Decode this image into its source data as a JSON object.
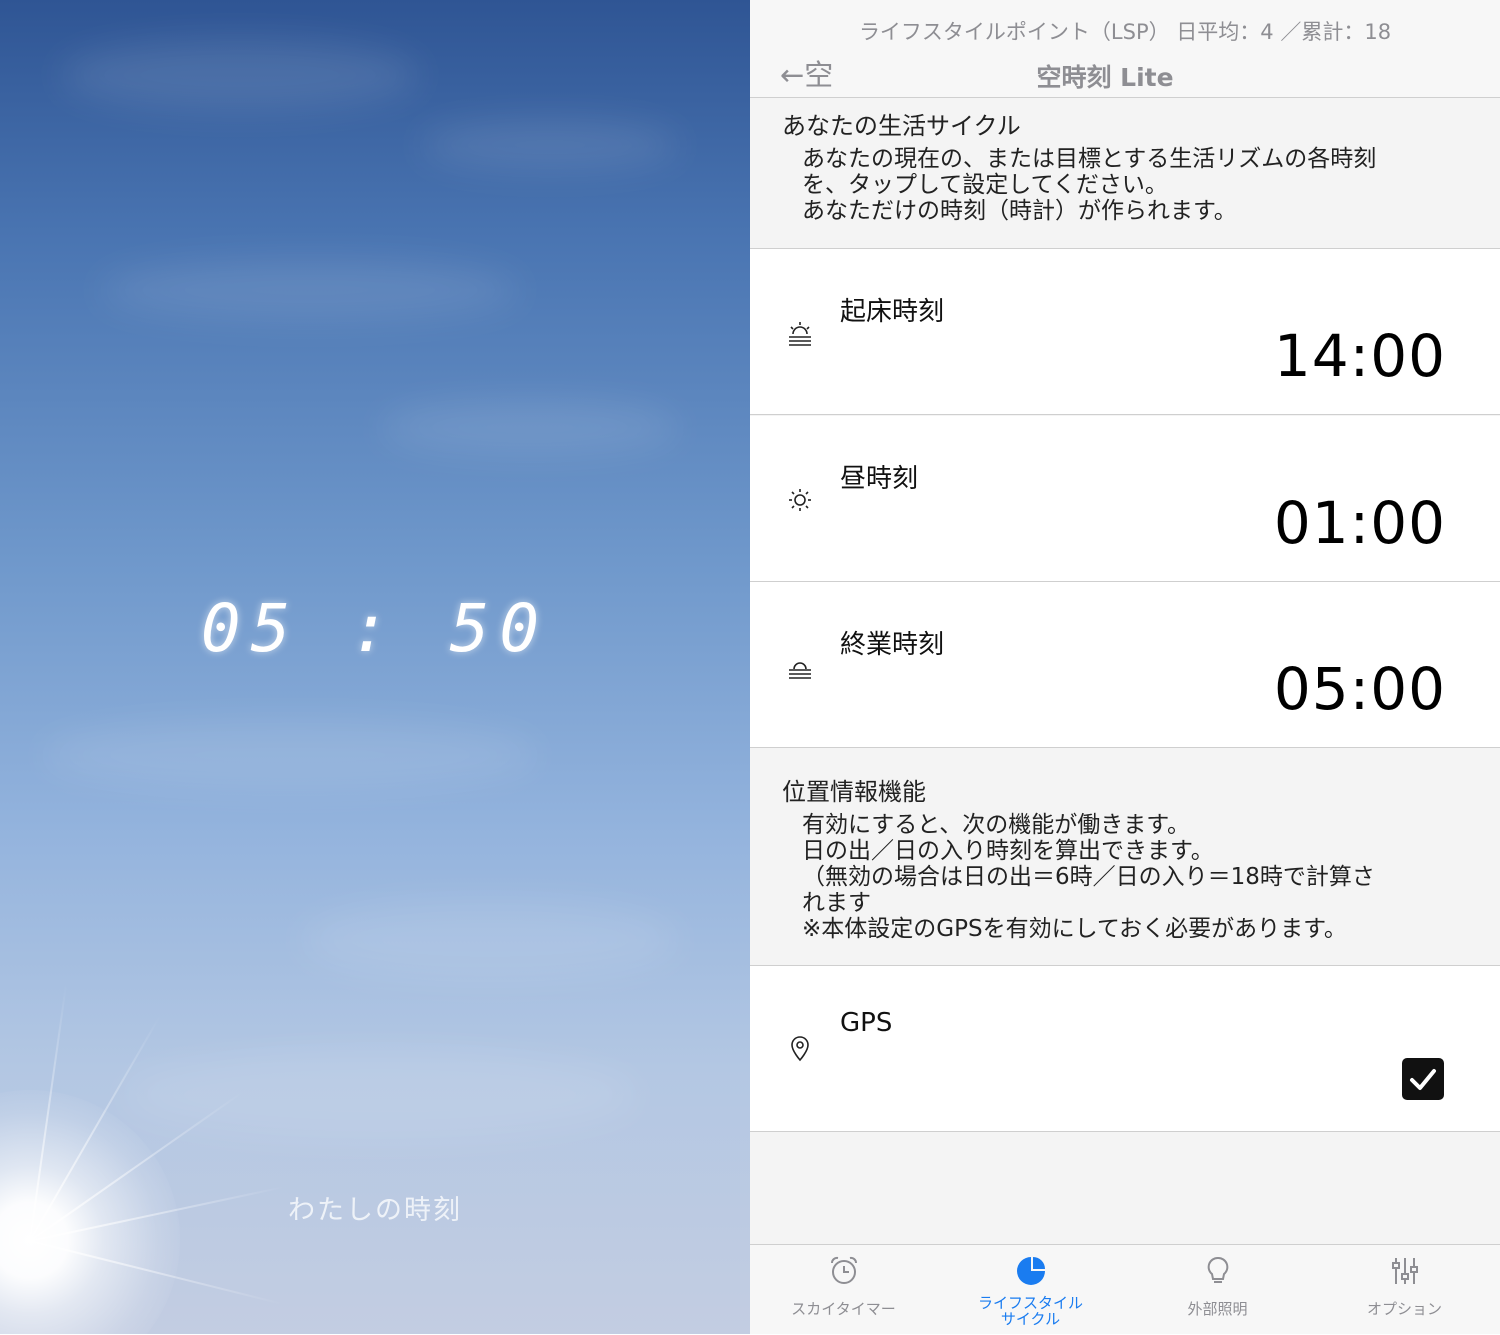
{
  "sky": {
    "time": "05 : 50",
    "caption": "わたしの時刻"
  },
  "header": {
    "lsp": "ライフスタイルポイント（LSP）  日平均：4 ／累計：18",
    "back": "←空",
    "title": "空時刻 Lite"
  },
  "cycle_section": {
    "title": "あなたの生活サイクル",
    "desc": [
      "あなたの現在の、または目標とする生活リズムの各時刻",
      "を、タップして設定してください。",
      "あなただけの時刻（時計）が作られます。"
    ]
  },
  "rows": [
    {
      "label": "起床時刻",
      "value": "14:00",
      "icon": "sunrise-icon"
    },
    {
      "label": "昼時刻",
      "value": "01:00",
      "icon": "sun-icon"
    },
    {
      "label": "終業時刻",
      "value": "05:00",
      "icon": "sunset-icon"
    }
  ],
  "location_section": {
    "title": "位置情報機能",
    "desc": [
      "有効にすると、次の機能が働きます。",
      "日の出／日の入り時刻を算出できます。",
      "（無効の場合は日の出＝6時／日の入り＝18時で計算さ",
      "れます",
      "※本体設定のGPSを有効にしておく必要があります。"
    ]
  },
  "gps": {
    "label": "GPS",
    "checked": true,
    "icon": "location-pin-icon"
  },
  "tabs": [
    {
      "label": "スカイタイマー",
      "icon": "alarm-clock-icon",
      "active": false
    },
    {
      "label": "ライフスタイル サイクル",
      "label_line1": "ライフスタイル",
      "label_line2": "サイクル",
      "icon": "pie-chart-icon",
      "active": true
    },
    {
      "label": "外部照明",
      "icon": "lightbulb-icon",
      "active": false
    },
    {
      "label": "オプション",
      "icon": "sliders-icon",
      "active": false
    }
  ],
  "colors": {
    "accent": "#1a7cf0",
    "inactive": "#8e8e93"
  }
}
